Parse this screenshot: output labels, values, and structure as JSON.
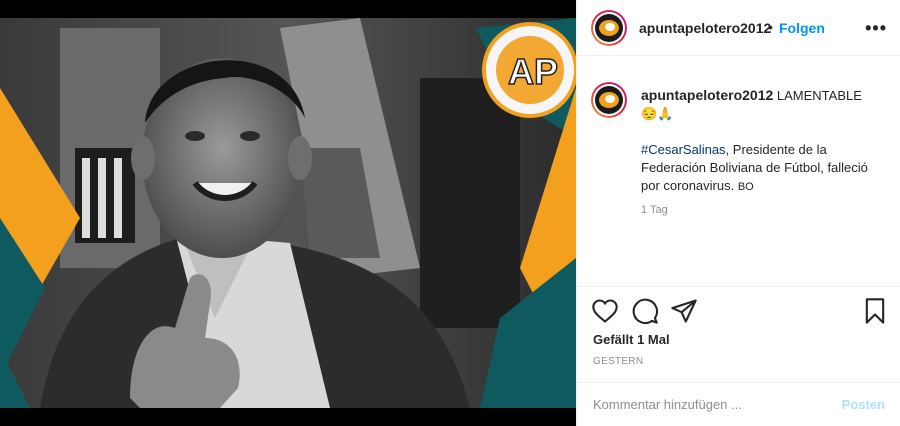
{
  "post": {
    "author": "apuntapelotero2012",
    "separator": "•",
    "follow_label": "Folgen",
    "more_label": "•••",
    "caption_word": "LAMENTABLE",
    "emojis": "😔🙏",
    "hashtag": "#CesarSalinas",
    "caption_body": ", Presidente de la Federación Boliviana de Fútbol, falleció por coronavirus.",
    "caption_tag": "BO",
    "time_ago": "1 Tag",
    "likes": "Gefällt 1 Mal",
    "date": "GESTERN"
  },
  "comment": {
    "placeholder": "Kommentar hinzufügen ...",
    "post_label": "Posten"
  },
  "colors": {
    "accent_orange": "#f2a01d",
    "teal": "#0f5a5e",
    "link_blue": "#0095f6",
    "hashtag_blue": "#00376b"
  },
  "photo": {
    "logo_text": "AP"
  }
}
